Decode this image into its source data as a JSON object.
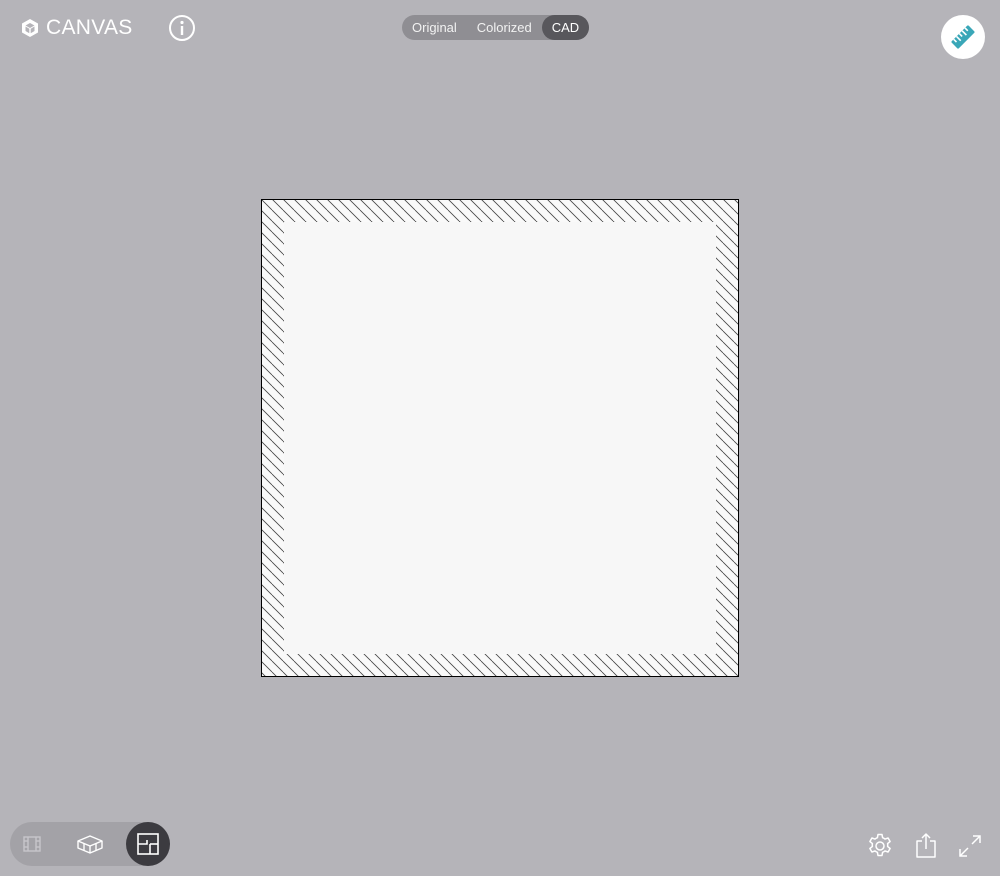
{
  "header": {
    "logo_text": "CANVAS",
    "logo_icon": "canvas-cube-icon",
    "info_icon": "info-icon"
  },
  "view_modes": {
    "items": [
      {
        "label": "Original",
        "active": false
      },
      {
        "label": "Colorized",
        "active": false
      },
      {
        "label": "CAD",
        "active": true
      }
    ]
  },
  "measure": {
    "icon": "ruler-icon",
    "accent_color": "#3aa7b8"
  },
  "colors": {
    "background": "#b5b4b9",
    "toggle_background": "#8f8e93",
    "toggle_active": "#58575c",
    "wall_outline": "#000000",
    "room_fill": "#f7f7f7"
  },
  "bottom_left_modes": [
    {
      "name": "walls-3d-view",
      "icon": "walls-icon",
      "active": false
    },
    {
      "name": "perspective-3d-view",
      "icon": "3d-box-icon",
      "active": false
    },
    {
      "name": "floor-plan-view",
      "icon": "floor-plan-icon",
      "active": true
    }
  ],
  "bottom_right_actions": [
    {
      "name": "settings",
      "icon": "gear-icon"
    },
    {
      "name": "share",
      "icon": "share-icon"
    },
    {
      "name": "fullscreen",
      "icon": "expand-icon"
    }
  ]
}
